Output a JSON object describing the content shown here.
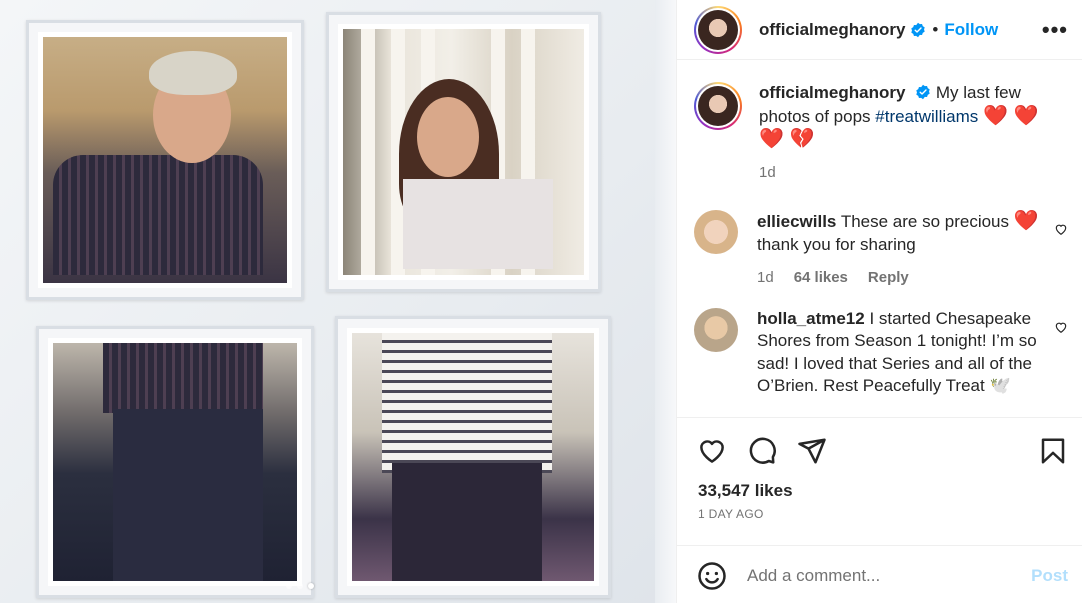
{
  "post": {
    "username": "officialmeghanory",
    "follow_label": "Follow",
    "separator": "•",
    "more_label": "•••"
  },
  "caption": {
    "username": "officialmeghanory",
    "text_start": "My last few photos of pops",
    "hashtag": "#treatwilliams",
    "emoji_line1": "❤️ ❤️",
    "emoji_line2": "❤️ 💔",
    "time": "1d"
  },
  "comments": [
    {
      "username": "elliecwills",
      "text": "These are so precious",
      "emoji": "❤️",
      "text2": "thank you for sharing",
      "time": "1d",
      "likes": "64 likes",
      "reply": "Reply"
    },
    {
      "username": "holla_atme12",
      "text": "I started Chesapeake Shores from Season 1 tonight! I’m so sad! I loved that Series and all of the O’Brien. Rest Peacefully Treat",
      "emoji": "🕊️"
    }
  ],
  "stats": {
    "likes": "33,547 likes",
    "ago": "1 DAY AGO"
  },
  "composer": {
    "placeholder": "Add a comment...",
    "post_label": "Post"
  },
  "carousel": {
    "count": 3,
    "active_index": 2
  },
  "colors": {
    "accent": "#0095f6",
    "hashtag": "#00376b",
    "muted": "#737373",
    "post_disabled": "#b2dffc"
  }
}
